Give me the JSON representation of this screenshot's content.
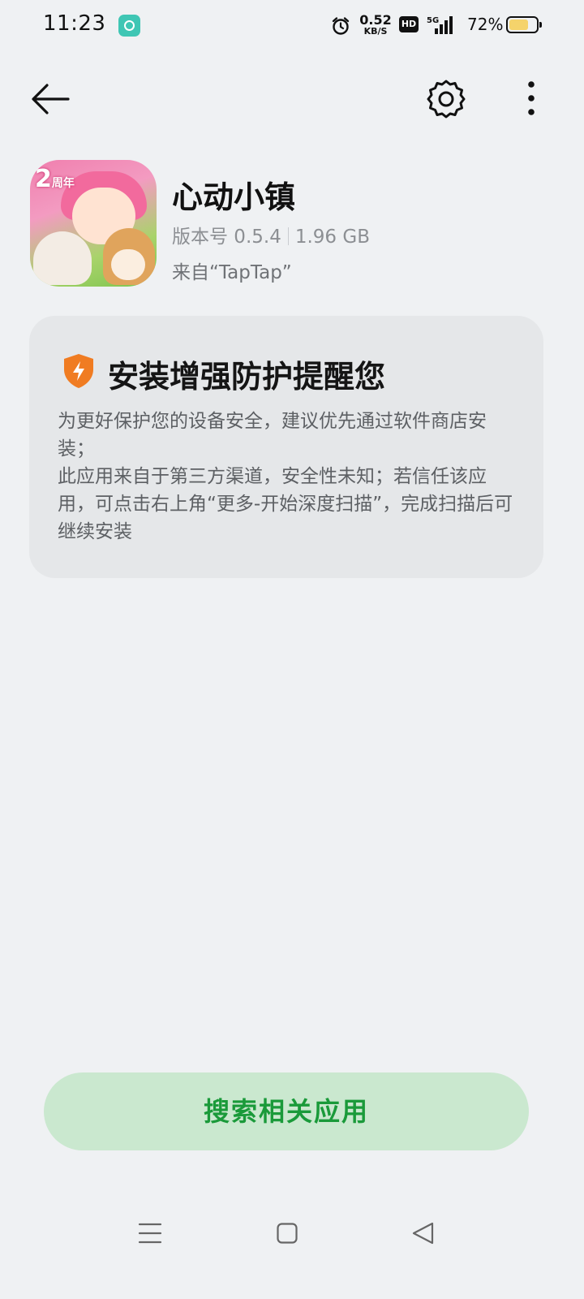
{
  "status_bar": {
    "time": "11:23",
    "net_speed_value": "0.52",
    "net_speed_unit": "KB/S",
    "hd_label": "HD",
    "network_label": "5G",
    "battery_percent": "72%",
    "battery_level": 0.72
  },
  "header": {
    "back_icon": "arrow-left-icon",
    "settings_icon": "gear-icon",
    "more_icon": "more-vertical-icon"
  },
  "app": {
    "name": "心动小镇",
    "version_label": "版本号 0.5.4",
    "size": "1.96 GB",
    "source": "来自“TapTap”",
    "icon_badge": "2",
    "icon_badge_suffix": "周年"
  },
  "warning_card": {
    "title": "安装增强防护提醒您",
    "line1": "为更好保护您的设备安全，建议优先通过软件商店安装；",
    "line2": "此应用来自于第三方渠道，安全性未知；若信任该应用，可点击右上角“更多-开始深度扫描”，完成扫描后可继续安装",
    "shield_color": "#f07c22"
  },
  "actions": {
    "search_label": "搜索相关应用"
  },
  "colors": {
    "accent_green": "#1a9a3a",
    "button_bg": "#cae8cf",
    "page_bg": "#eff1f3"
  }
}
